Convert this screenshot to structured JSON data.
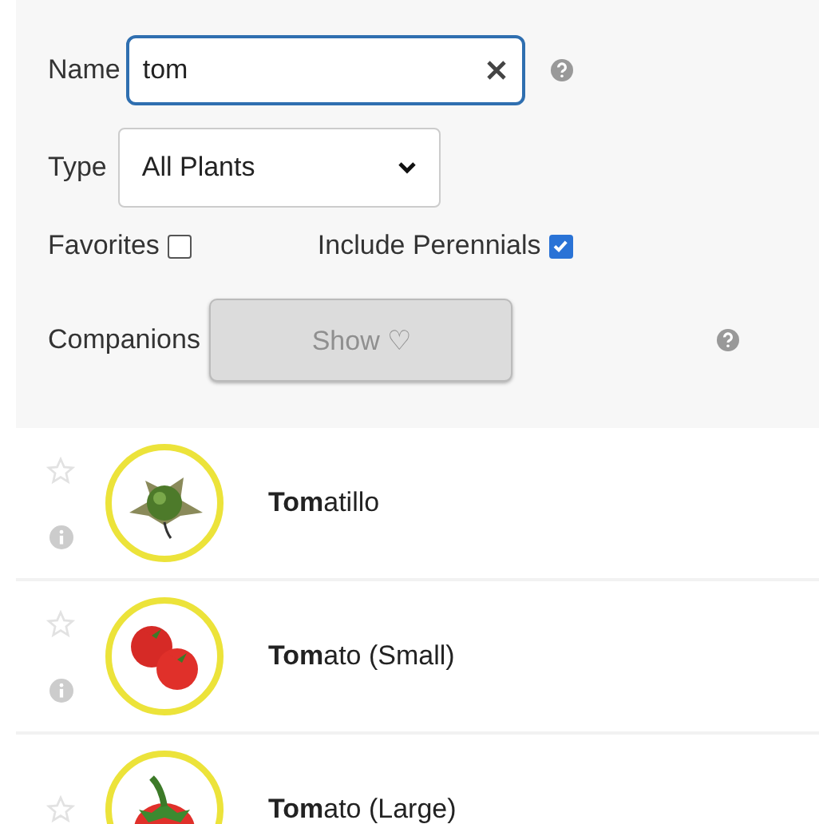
{
  "filters": {
    "name_label": "Name",
    "name_value": "tom",
    "type_label": "Type",
    "type_value": "All Plants",
    "favorites_label": "Favorites",
    "favorites_checked": false,
    "perennials_label": "Include Perennials",
    "perennials_checked": true,
    "companions_label": "Companions",
    "companions_button": "Show ♡",
    "companions_disabled": true
  },
  "plants": [
    {
      "name": "**Tom**atillo",
      "kind": "tomatillo",
      "favorite": false,
      "info": true
    },
    {
      "name": "**Tom**ato (Small)",
      "kind": "tomato-pair",
      "favorite": false,
      "info": true
    },
    {
      "name": "**Tom**ato (Large)",
      "kind": "tomato-large",
      "favorite": false,
      "info": false
    }
  ]
}
